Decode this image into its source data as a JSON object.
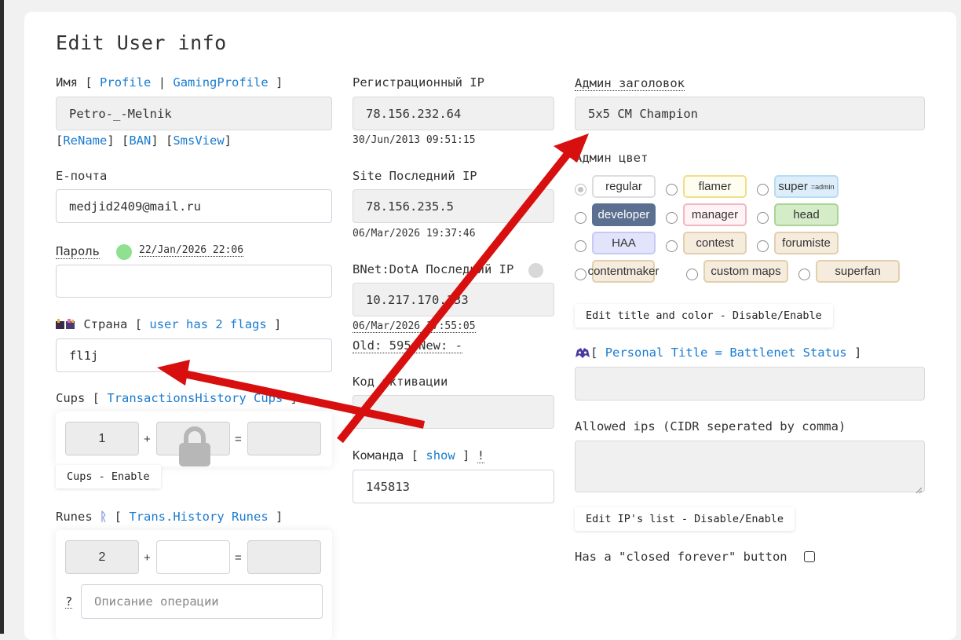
{
  "page": {
    "title": "Edit User info"
  },
  "name_section": {
    "label": "Имя",
    "bracket_open": "[",
    "bracket_close": "]",
    "separator": "|",
    "link_profile": "Profile",
    "link_gaming": "GamingProfile",
    "value": "Petro-_-Melnik",
    "action_rename": "ReName",
    "action_ban": "BAN",
    "action_smsview": "SmsView"
  },
  "email": {
    "label": "E-почта",
    "value": "medjid2409@mail.ru"
  },
  "password": {
    "label": "Пароль",
    "timestamp": "22/Jan/2026 22:06",
    "status_color": "#8fe08f",
    "value": ""
  },
  "country": {
    "flags_icon": "country-flags-icon",
    "label": "Страна",
    "link_flags": "user has 2 flags",
    "value": "fl1j"
  },
  "cups": {
    "label": "Cups",
    "link_history": "TransactionsHistory Cups",
    "current": "1",
    "plus": "+",
    "equals": "=",
    "add": "",
    "result": "",
    "lock_icon": "lock-icon",
    "toggle_label": "Cups - Enable"
  },
  "runes": {
    "label": "Runes",
    "icon_char": "ᚱ",
    "link_history": "Trans.History Runes",
    "current": "2",
    "plus": "+",
    "equals": "=",
    "add": "",
    "result": "",
    "help_mark": "?",
    "description_placeholder": "Описание операции"
  },
  "reg_ip": {
    "label": "Регистрационный IP",
    "value": "78.156.232.64",
    "date": "30/Jun/2013 09:51:15"
  },
  "site_ip": {
    "label": "Site Последний IP",
    "value": "78.156.235.5",
    "date": "06/Mar/2026 19:37:46"
  },
  "bnet_ip": {
    "label": "BNet:DotA Последний IP",
    "status_color": "#d8d8d8",
    "value": "10.217.170.133",
    "date": "06/Mar/2026 17:55:05",
    "old_new": "Old: 595 New: -"
  },
  "activation": {
    "label": "Код активации",
    "value": ""
  },
  "team": {
    "label": "Команда",
    "link_show": "show",
    "warning": "!",
    "value": "145813"
  },
  "admin_title": {
    "label": "Админ заголовок",
    "value": "5x5 CM Champion"
  },
  "admin_color": {
    "label": "Админ цвет",
    "options": [
      {
        "label": "regular",
        "sub": "",
        "bg": "#ffffff",
        "border": "#dddddd",
        "checked": true
      },
      {
        "label": "flamer",
        "sub": "",
        "bg": "#fffdf0",
        "border": "#f2de8a",
        "checked": false
      },
      {
        "label": "super",
        "sub": "=admin",
        "bg": "#ddeefa",
        "border": "#b8dcf2",
        "checked": false
      },
      {
        "label": "developer",
        "sub": "",
        "bg": "#5b6f90",
        "border": "#5b6f90",
        "fg": "#ffffff",
        "checked": false
      },
      {
        "label": "manager",
        "sub": "",
        "bg": "#fff3f5",
        "border": "#f0b7c4",
        "checked": false
      },
      {
        "label": "head",
        "sub": "",
        "bg": "#d4ecc8",
        "border": "#a9d495",
        "checked": false
      },
      {
        "label": "HAA",
        "sub": "",
        "bg": "#e2e4fb",
        "border": "#c6caf2",
        "checked": false
      },
      {
        "label": "contest",
        "sub": "",
        "bg": "#f6ecdd",
        "border": "#e3cfae",
        "checked": false
      },
      {
        "label": "forumiste",
        "sub": "",
        "bg": "#f6ecdd",
        "border": "#e3cfae",
        "checked": false
      },
      {
        "label": "contentmaker",
        "sub": "",
        "bg": "#f6ecdd",
        "border": "#e3cfae",
        "checked": false
      },
      {
        "label": "custom maps",
        "sub": "",
        "bg": "#f6ecdd",
        "border": "#e3cfae",
        "checked": false
      },
      {
        "label": "superfan",
        "sub": "",
        "bg": "#f6ecdd",
        "border": "#e3cfae",
        "checked": false
      }
    ],
    "toggle_label": "Edit title and color - Disable/Enable"
  },
  "personal_title": {
    "icon": "mask-icon",
    "link": "Personal Title = Battlenet Status",
    "value": ""
  },
  "allowed_ips": {
    "label": "Allowed ips (CIDR seperated by comma)",
    "value": "",
    "toggle_label": "Edit IP's list - Disable/Enable"
  },
  "closed_forever": {
    "label": "Has a \"closed forever\" button",
    "checked": false
  },
  "annotation": {
    "arrow_color": "#d80f0f"
  }
}
